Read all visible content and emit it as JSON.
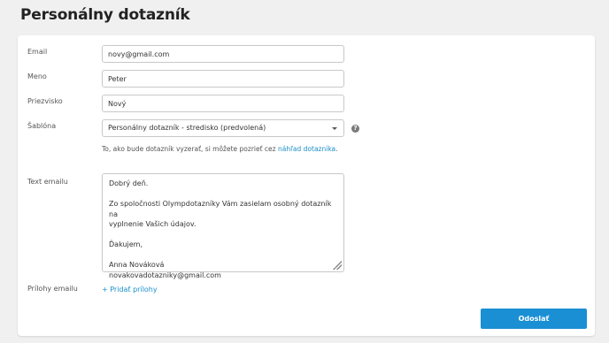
{
  "page": {
    "title": "Personálny dotazník"
  },
  "form": {
    "email": {
      "label": "Email",
      "value": "novy@gmail.com"
    },
    "first_name": {
      "label": "Meno",
      "value": "Peter"
    },
    "last_name": {
      "label": "Priezvisko",
      "value": "Nový"
    },
    "template": {
      "label": "Šablóna",
      "selected": "Personálny dotazník - stredisko (predvolená)",
      "help_icon": "question-icon",
      "help_glyph": "?",
      "hint_text": "To, ako bude dotazník vyzerať, si môžete pozrieť cez ",
      "hint_link": "náhľad dotazníka",
      "hint_suffix": "."
    },
    "email_text": {
      "label": "Text emailu",
      "paragraphs": [
        "Dobrý deň.",
        "Zo spoločnosti Olympdotazníky Vám zasielam osobný dotazník na\nvyplnenie Vašich údajov.",
        "Ďakujem,",
        "Anna Nováková\nnovakovadotazniky@gmail.com"
      ]
    },
    "attachments": {
      "label": "Prílohy emailu",
      "add_link": "+ Pridať prílohy"
    },
    "submit_label": "Odoslať"
  },
  "colors": {
    "accent": "#1a8fd4",
    "link": "#1a8fc9"
  }
}
